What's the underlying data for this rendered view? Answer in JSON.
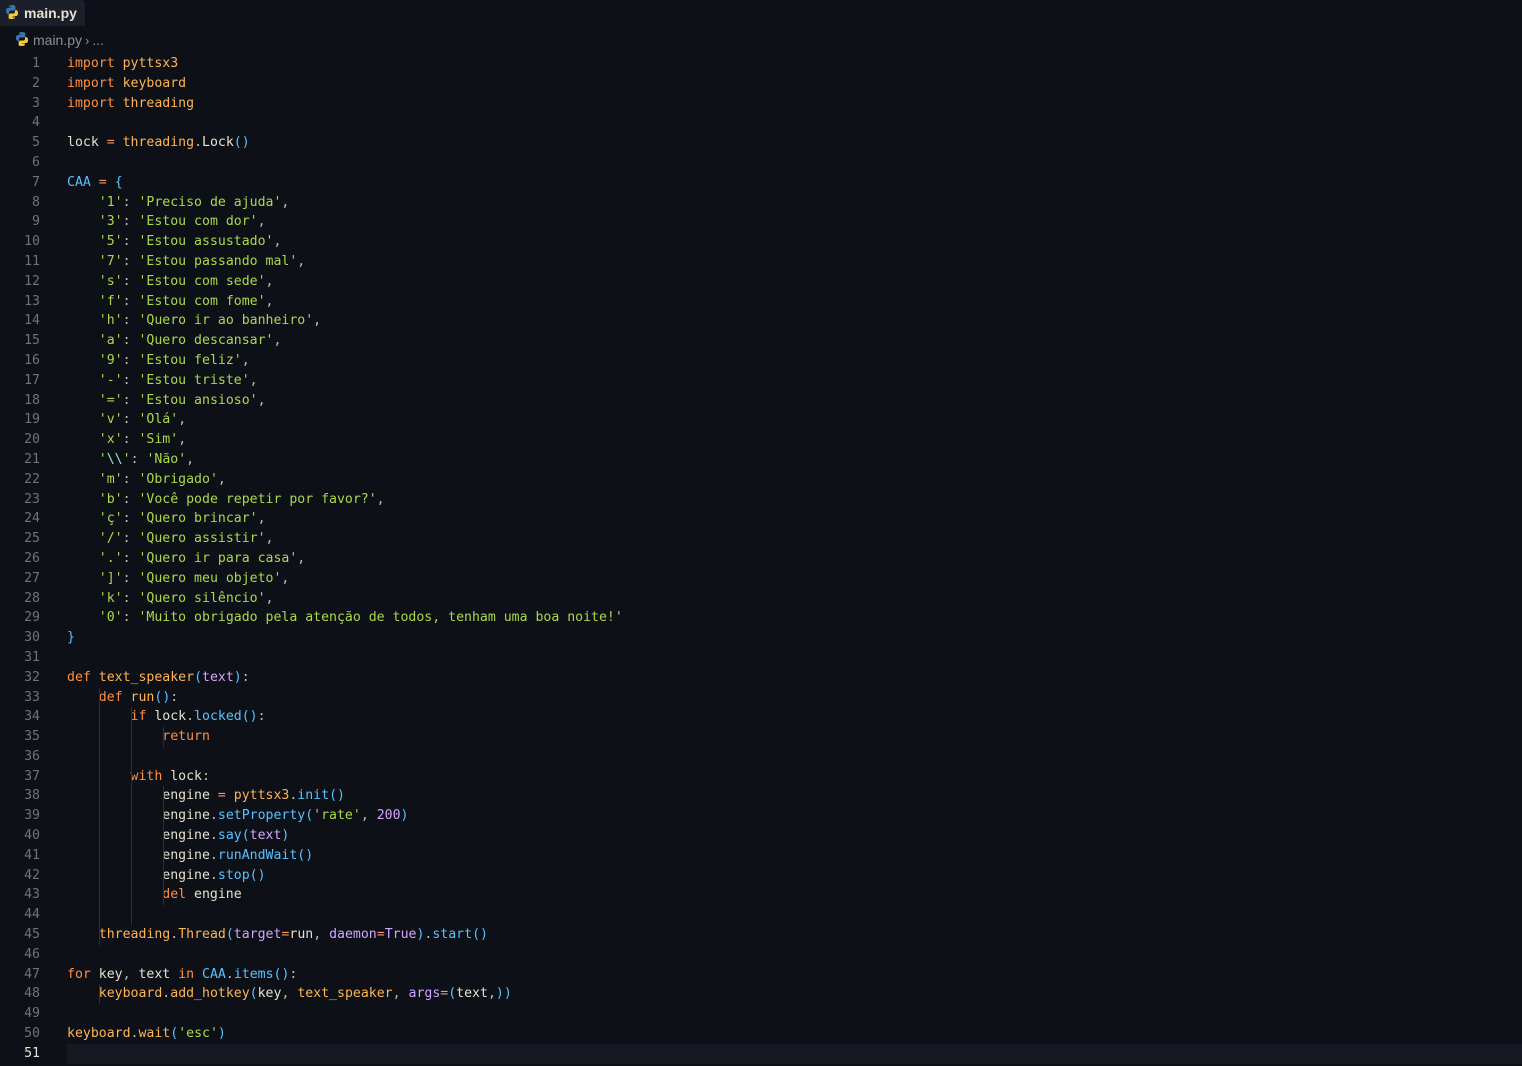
{
  "tab": {
    "title": "main.py",
    "icon": "python-icon"
  },
  "breadcrumb": {
    "file": "main.py",
    "rest": "..."
  },
  "editor": {
    "current_line": 51,
    "lines": [
      [
        [
          "kw",
          "import"
        ],
        [
          "txt",
          " "
        ],
        [
          "mod",
          "pyttsx3"
        ]
      ],
      [
        [
          "kw",
          "import"
        ],
        [
          "txt",
          " "
        ],
        [
          "mod",
          "keyboard"
        ]
      ],
      [
        [
          "kw",
          "import"
        ],
        [
          "txt",
          " "
        ],
        [
          "mod",
          "threading"
        ]
      ],
      [],
      [
        [
          "txt",
          "lock "
        ],
        [
          "op",
          "="
        ],
        [
          "txt",
          " "
        ],
        [
          "mod",
          "threading"
        ],
        [
          "punc",
          "."
        ],
        [
          "txt",
          "Lock"
        ],
        [
          "paren",
          "()"
        ]
      ],
      [],
      [
        [
          "const",
          "CAA"
        ],
        [
          "txt",
          " "
        ],
        [
          "op",
          "="
        ],
        [
          "txt",
          " "
        ],
        [
          "paren",
          "{"
        ]
      ],
      [
        [
          "txt",
          "    "
        ],
        [
          "str",
          "'1'"
        ],
        [
          "punc",
          ": "
        ],
        [
          "str",
          "'Preciso de ajuda'"
        ],
        [
          "punc",
          ","
        ]
      ],
      [
        [
          "txt",
          "    "
        ],
        [
          "str",
          "'3'"
        ],
        [
          "punc",
          ": "
        ],
        [
          "str",
          "'Estou com dor'"
        ],
        [
          "punc",
          ","
        ]
      ],
      [
        [
          "txt",
          "    "
        ],
        [
          "str",
          "'5'"
        ],
        [
          "punc",
          ": "
        ],
        [
          "str",
          "'Estou assustado'"
        ],
        [
          "punc",
          ","
        ]
      ],
      [
        [
          "txt",
          "    "
        ],
        [
          "str",
          "'7'"
        ],
        [
          "punc",
          ": "
        ],
        [
          "str",
          "'Estou passando mal'"
        ],
        [
          "punc",
          ","
        ]
      ],
      [
        [
          "txt",
          "    "
        ],
        [
          "str",
          "'s'"
        ],
        [
          "punc",
          ": "
        ],
        [
          "str",
          "'Estou com sede'"
        ],
        [
          "punc",
          ","
        ]
      ],
      [
        [
          "txt",
          "    "
        ],
        [
          "str",
          "'f'"
        ],
        [
          "punc",
          ": "
        ],
        [
          "str",
          "'Estou com fome'"
        ],
        [
          "punc",
          ","
        ]
      ],
      [
        [
          "txt",
          "    "
        ],
        [
          "str",
          "'h'"
        ],
        [
          "punc",
          ": "
        ],
        [
          "str",
          "'Quero ir ao banheiro'"
        ],
        [
          "punc",
          ","
        ]
      ],
      [
        [
          "txt",
          "    "
        ],
        [
          "str",
          "'a'"
        ],
        [
          "punc",
          ": "
        ],
        [
          "str",
          "'Quero descansar'"
        ],
        [
          "punc",
          ","
        ]
      ],
      [
        [
          "txt",
          "    "
        ],
        [
          "str",
          "'9'"
        ],
        [
          "punc",
          ": "
        ],
        [
          "str",
          "'Estou feliz'"
        ],
        [
          "punc",
          ","
        ]
      ],
      [
        [
          "txt",
          "    "
        ],
        [
          "str",
          "'-'"
        ],
        [
          "punc",
          ": "
        ],
        [
          "str",
          "'Estou triste'"
        ],
        [
          "punc",
          ","
        ]
      ],
      [
        [
          "txt",
          "    "
        ],
        [
          "str",
          "'='"
        ],
        [
          "punc",
          ": "
        ],
        [
          "str",
          "'Estou ansioso'"
        ],
        [
          "punc",
          ","
        ]
      ],
      [
        [
          "txt",
          "    "
        ],
        [
          "str",
          "'v'"
        ],
        [
          "punc",
          ": "
        ],
        [
          "str",
          "'Olá'"
        ],
        [
          "punc",
          ","
        ]
      ],
      [
        [
          "txt",
          "    "
        ],
        [
          "str",
          "'x'"
        ],
        [
          "punc",
          ": "
        ],
        [
          "str",
          "'Sim'"
        ],
        [
          "punc",
          ","
        ]
      ],
      [
        [
          "txt",
          "    "
        ],
        [
          "str",
          "'"
        ],
        [
          "esc",
          "\\\\"
        ],
        [
          "str",
          "'"
        ],
        [
          "punc",
          ": "
        ],
        [
          "str",
          "'Não'"
        ],
        [
          "punc",
          ","
        ]
      ],
      [
        [
          "txt",
          "    "
        ],
        [
          "str",
          "'m'"
        ],
        [
          "punc",
          ": "
        ],
        [
          "str",
          "'Obrigado'"
        ],
        [
          "punc",
          ","
        ]
      ],
      [
        [
          "txt",
          "    "
        ],
        [
          "str",
          "'b'"
        ],
        [
          "punc",
          ": "
        ],
        [
          "str",
          "'Você pode repetir por favor?'"
        ],
        [
          "punc",
          ","
        ]
      ],
      [
        [
          "txt",
          "    "
        ],
        [
          "str",
          "'ç'"
        ],
        [
          "punc",
          ": "
        ],
        [
          "str",
          "'Quero brincar'"
        ],
        [
          "punc",
          ","
        ]
      ],
      [
        [
          "txt",
          "    "
        ],
        [
          "str",
          "'/'"
        ],
        [
          "punc",
          ": "
        ],
        [
          "str",
          "'Quero assistir'"
        ],
        [
          "punc",
          ","
        ]
      ],
      [
        [
          "txt",
          "    "
        ],
        [
          "str",
          "'.'"
        ],
        [
          "punc",
          ": "
        ],
        [
          "str",
          "'Quero ir para casa'"
        ],
        [
          "punc",
          ","
        ]
      ],
      [
        [
          "txt",
          "    "
        ],
        [
          "str",
          "']'"
        ],
        [
          "punc",
          ": "
        ],
        [
          "str",
          "'Quero meu objeto'"
        ],
        [
          "punc",
          ","
        ]
      ],
      [
        [
          "txt",
          "    "
        ],
        [
          "str",
          "'k'"
        ],
        [
          "punc",
          ": "
        ],
        [
          "str",
          "'Quero silêncio'"
        ],
        [
          "punc",
          ","
        ]
      ],
      [
        [
          "txt",
          "    "
        ],
        [
          "str",
          "'0'"
        ],
        [
          "punc",
          ": "
        ],
        [
          "str",
          "'Muito obrigado pela atenção de todos, tenham uma boa noite!'"
        ]
      ],
      [
        [
          "paren",
          "}"
        ]
      ],
      [],
      [
        [
          "kw",
          "def"
        ],
        [
          "txt",
          " "
        ],
        [
          "fn",
          "text_speaker"
        ],
        [
          "paren",
          "("
        ],
        [
          "param",
          "text"
        ],
        [
          "paren",
          ")"
        ],
        [
          "punc",
          ":"
        ]
      ],
      [
        [
          "txt",
          "    "
        ],
        [
          "kw",
          "def"
        ],
        [
          "txt",
          " "
        ],
        [
          "fn",
          "run"
        ],
        [
          "paren",
          "()"
        ],
        [
          "punc",
          ":"
        ]
      ],
      [
        [
          "txt",
          "        "
        ],
        [
          "kw",
          "if"
        ],
        [
          "txt",
          " lock"
        ],
        [
          "punc",
          "."
        ],
        [
          "meth",
          "locked"
        ],
        [
          "paren",
          "()"
        ],
        [
          "punc",
          ":"
        ]
      ],
      [
        [
          "txt",
          "            "
        ],
        [
          "kw",
          "return"
        ]
      ],
      [],
      [
        [
          "txt",
          "        "
        ],
        [
          "kw",
          "with"
        ],
        [
          "txt",
          " lock"
        ],
        [
          "punc",
          ":"
        ]
      ],
      [
        [
          "txt",
          "            engine "
        ],
        [
          "op",
          "="
        ],
        [
          "txt",
          " "
        ],
        [
          "mod",
          "pyttsx3"
        ],
        [
          "punc",
          "."
        ],
        [
          "meth",
          "init"
        ],
        [
          "paren",
          "()"
        ]
      ],
      [
        [
          "txt",
          "            engine"
        ],
        [
          "punc",
          "."
        ],
        [
          "meth",
          "setProperty"
        ],
        [
          "paren",
          "("
        ],
        [
          "str",
          "'rate'"
        ],
        [
          "punc",
          ", "
        ],
        [
          "num",
          "200"
        ],
        [
          "paren",
          ")"
        ]
      ],
      [
        [
          "txt",
          "            engine"
        ],
        [
          "punc",
          "."
        ],
        [
          "meth",
          "say"
        ],
        [
          "paren",
          "("
        ],
        [
          "param",
          "text"
        ],
        [
          "paren",
          ")"
        ]
      ],
      [
        [
          "txt",
          "            engine"
        ],
        [
          "punc",
          "."
        ],
        [
          "meth",
          "runAndWait"
        ],
        [
          "paren",
          "()"
        ]
      ],
      [
        [
          "txt",
          "            engine"
        ],
        [
          "punc",
          "."
        ],
        [
          "meth",
          "stop"
        ],
        [
          "paren",
          "()"
        ]
      ],
      [
        [
          "txt",
          "            "
        ],
        [
          "kw",
          "del"
        ],
        [
          "txt",
          " engine"
        ]
      ],
      [],
      [
        [
          "txt",
          "    "
        ],
        [
          "mod",
          "threading"
        ],
        [
          "punc",
          "."
        ],
        [
          "fn",
          "Thread"
        ],
        [
          "paren",
          "("
        ],
        [
          "param",
          "target"
        ],
        [
          "op",
          "="
        ],
        [
          "txt",
          "run"
        ],
        [
          "punc",
          ", "
        ],
        [
          "param",
          "daemon"
        ],
        [
          "op",
          "="
        ],
        [
          "num",
          "True"
        ],
        [
          "paren",
          ")"
        ],
        [
          "punc",
          "."
        ],
        [
          "meth",
          "start"
        ],
        [
          "paren",
          "()"
        ]
      ],
      [],
      [
        [
          "kw",
          "for"
        ],
        [
          "txt",
          " key"
        ],
        [
          "punc",
          ", "
        ],
        [
          "txt",
          "text "
        ],
        [
          "kw",
          "in"
        ],
        [
          "txt",
          " "
        ],
        [
          "const",
          "CAA"
        ],
        [
          "punc",
          "."
        ],
        [
          "meth",
          "items"
        ],
        [
          "paren",
          "()"
        ],
        [
          "punc",
          ":"
        ]
      ],
      [
        [
          "txt",
          "    "
        ],
        [
          "mod",
          "keyboard"
        ],
        [
          "punc",
          "."
        ],
        [
          "fn",
          "add_hotkey"
        ],
        [
          "paren",
          "("
        ],
        [
          "txt",
          "key"
        ],
        [
          "punc",
          ", "
        ],
        [
          "fn",
          "text_speaker"
        ],
        [
          "punc",
          ", "
        ],
        [
          "param",
          "args"
        ],
        [
          "op",
          "="
        ],
        [
          "paren",
          "("
        ],
        [
          "txt",
          "text"
        ],
        [
          "punc",
          ","
        ],
        [
          "paren",
          "))"
        ]
      ],
      [],
      [
        [
          "mod",
          "keyboard"
        ],
        [
          "punc",
          "."
        ],
        [
          "fn",
          "wait"
        ],
        [
          "paren",
          "("
        ],
        [
          "str",
          "'esc'"
        ],
        [
          "paren",
          ")"
        ]
      ],
      []
    ]
  }
}
